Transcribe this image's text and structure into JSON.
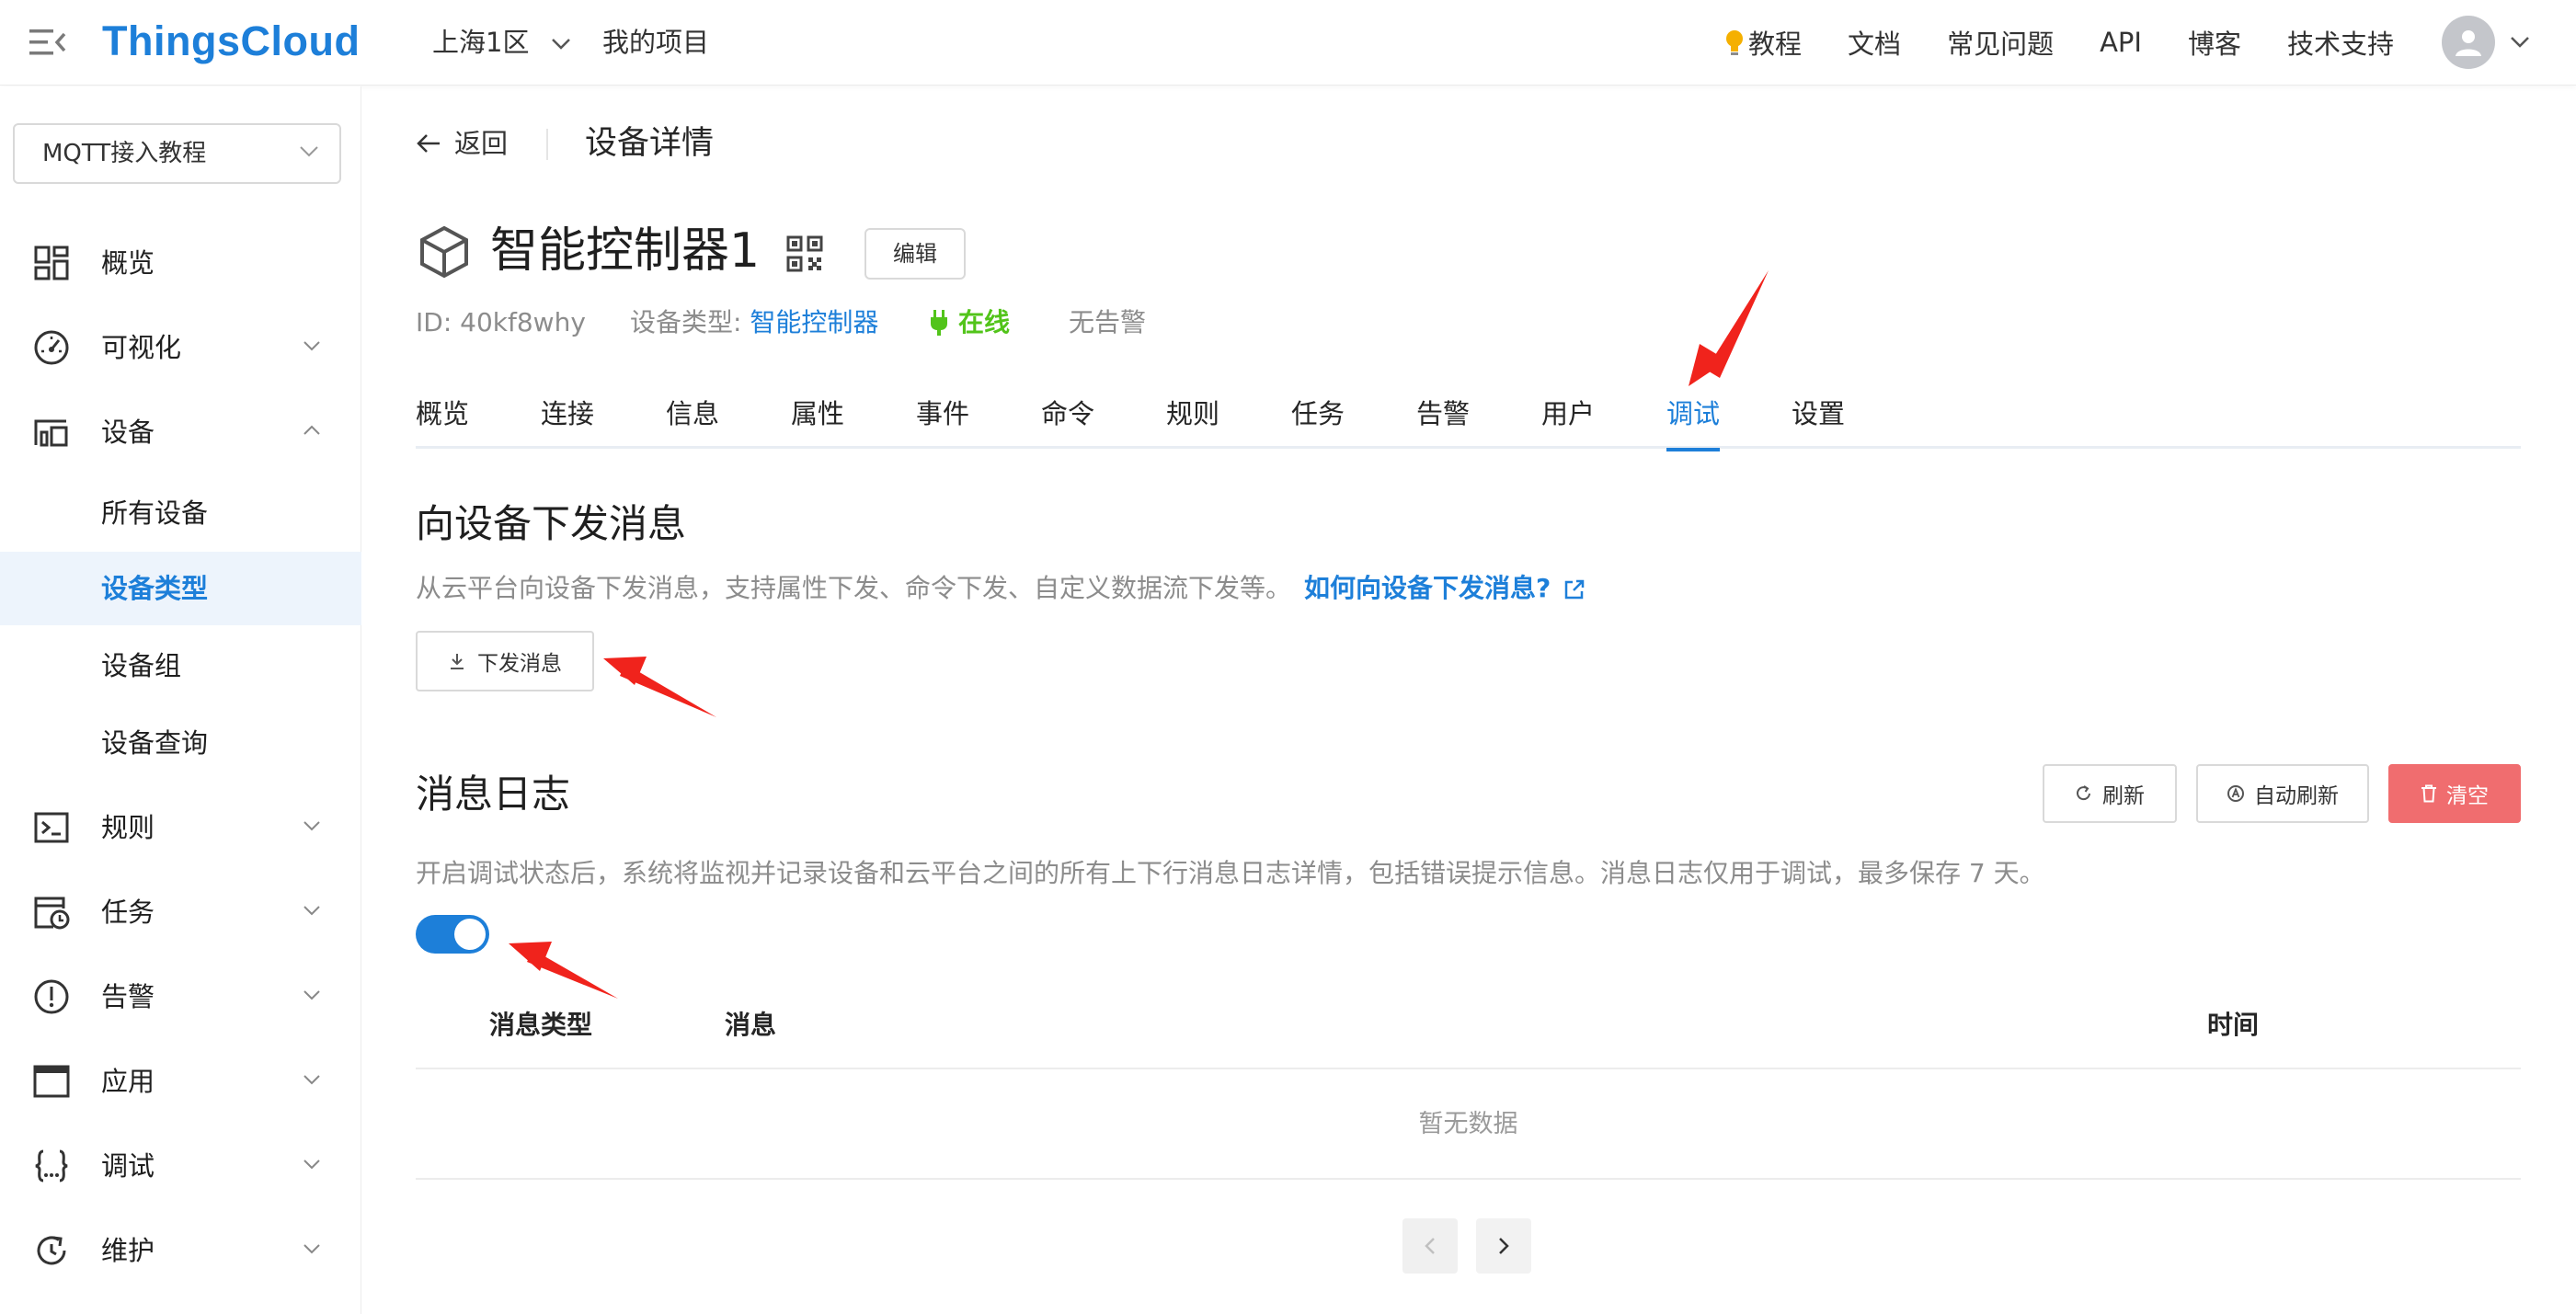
{
  "header": {
    "logo": "ThingsCloud",
    "region": "上海1区",
    "my_project": "我的项目",
    "nav": [
      "教程",
      "文档",
      "常见问题",
      "API",
      "博客",
      "技术支持"
    ]
  },
  "sidebar": {
    "project_select": "MQTT接入教程",
    "items": [
      {
        "label": "概览",
        "icon": "dashboard-icon"
      },
      {
        "label": "可视化",
        "icon": "gauge-icon"
      },
      {
        "label": "设备",
        "icon": "devices-icon"
      },
      {
        "label": "规则",
        "icon": "terminal-icon"
      },
      {
        "label": "任务",
        "icon": "schedule-icon"
      },
      {
        "label": "告警",
        "icon": "alert-icon"
      },
      {
        "label": "应用",
        "icon": "window-icon"
      },
      {
        "label": "调试",
        "icon": "braces-icon"
      },
      {
        "label": "维护",
        "icon": "refresh-icon"
      }
    ],
    "device_sub": [
      "所有设备",
      "设备类型",
      "设备组",
      "设备查询"
    ],
    "active_sub": "设备类型"
  },
  "page": {
    "back": "返回",
    "title": "设备详情"
  },
  "device": {
    "name": "智能控制器1",
    "edit": "编辑",
    "id": "ID: 40kf8why",
    "type_label": "设备类型:",
    "type_value": "智能控制器",
    "status": "在线",
    "alarm": "无告警"
  },
  "tabs": [
    "概览",
    "连接",
    "信息",
    "属性",
    "事件",
    "命令",
    "规则",
    "任务",
    "告警",
    "用户",
    "调试",
    "设置"
  ],
  "active_tab": "调试",
  "send_section": {
    "title": "向设备下发消息",
    "desc": "从云平台向设备下发消息，支持属性下发、命令下发、自定义数据流下发等。",
    "help_link": "如何向设备下发消息?",
    "button": "下发消息"
  },
  "log_section": {
    "title": "消息日志",
    "desc": "开启调试状态后，系统将监视并记录设备和云平台之间的所有上下行消息日志详情，包括错误提示信息。消息日志仅用于调试，最多保存 7 天。",
    "refresh": "刷新",
    "auto_refresh": "自动刷新",
    "clear": "清空",
    "debug_enabled": true,
    "columns": [
      "消息类型",
      "消息",
      "时间"
    ],
    "empty": "暂无数据"
  },
  "colors": {
    "primary": "#1d7fd9",
    "online": "#52c41a",
    "danger": "#f06d6f",
    "annotation_arrow": "#f0231c"
  }
}
